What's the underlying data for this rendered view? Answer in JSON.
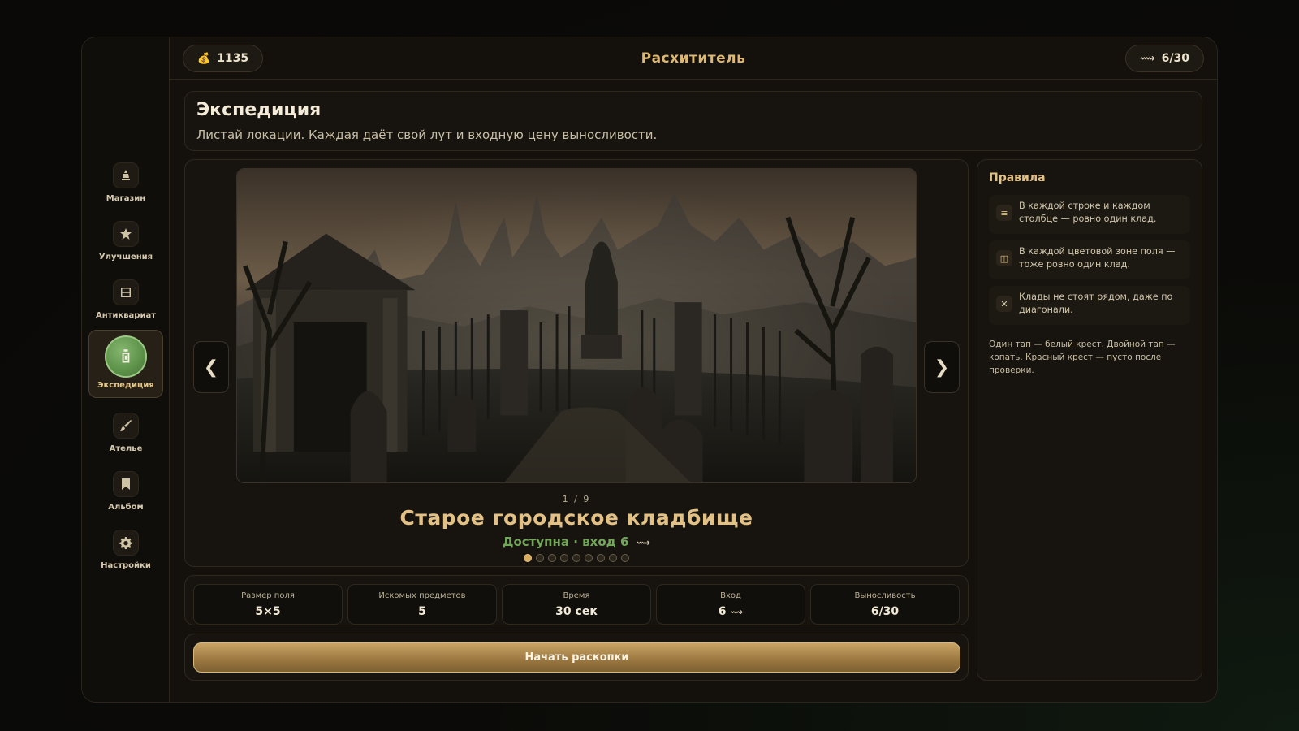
{
  "topbar": {
    "coins": "1135",
    "title": "Расхититель",
    "stamina": "6/30",
    "coin_icon": "coin-bag-icon",
    "stamina_icon": "key-icon"
  },
  "sidebar": {
    "items": [
      {
        "label": "Магазин",
        "icon": "shop-icon",
        "active": false
      },
      {
        "label": "Улучшения",
        "icon": "star-icon",
        "active": false
      },
      {
        "label": "Антиквариат",
        "icon": "cabinet-icon",
        "active": false
      },
      {
        "label": "Экспедиция",
        "icon": "lantern-icon",
        "active": true
      },
      {
        "label": "Ателье",
        "icon": "brush-icon",
        "active": false
      },
      {
        "label": "Альбом",
        "icon": "bookmark-icon",
        "active": false
      },
      {
        "label": "Настройки",
        "icon": "gear-icon",
        "active": false
      }
    ]
  },
  "header": {
    "title": "Экспедиция",
    "subtitle": "Листай локации. Каждая даёт свой лут и входную цену выносливости."
  },
  "carousel": {
    "prev_label": "❮",
    "next_label": "❯",
    "counter": "1 / 9",
    "current_index": 1,
    "total": 9,
    "location_name": "Старое городское кладбище",
    "status": "Доступна · вход 6",
    "image": "gothic-cemetery-scene"
  },
  "stats": [
    {
      "label": "Размер поля",
      "value": "5×5"
    },
    {
      "label": "Искомых предметов",
      "value": "5"
    },
    {
      "label": "Время",
      "value": "30 сек"
    },
    {
      "label": "Вход",
      "value": "6"
    },
    {
      "label": "Выносливость",
      "value": "6/30"
    }
  ],
  "action": {
    "start_label": "Начать раскопки"
  },
  "rules": {
    "title": "Правила",
    "items": [
      {
        "icon": "rows-icon",
        "text": "В каждой строке и каждом столбце — ровно один клад."
      },
      {
        "icon": "zone-icon",
        "text": "В каждой цветовой зоне поля — тоже ровно один клад."
      },
      {
        "icon": "cross-icon",
        "text": "Клады не стоят рядом, даже по диагонали."
      }
    ],
    "note": "Один тап — белый крест. Двойной тап — копать. Красный крест — пусто после проверки."
  },
  "colors": {
    "accent": "#ddb874",
    "available": "#72a75a",
    "active_nav": "#5f944b",
    "button": "#9a7740"
  }
}
